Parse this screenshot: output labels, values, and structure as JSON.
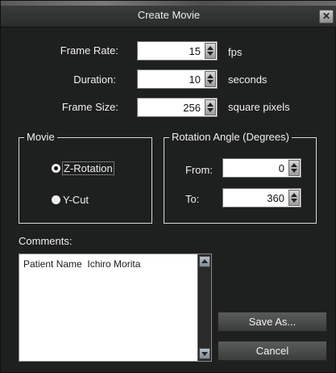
{
  "window": {
    "title": "Create Movie",
    "close_glyph": "✕"
  },
  "fields": {
    "frame_rate": {
      "label": "Frame Rate:",
      "value": "15",
      "unit": "fps"
    },
    "duration": {
      "label": "Duration:",
      "value": "10",
      "unit": "seconds"
    },
    "frame_size": {
      "label": "Frame Size:",
      "value": "256",
      "unit": "square pixels"
    }
  },
  "movie_group": {
    "legend": "Movie",
    "options": [
      {
        "label": "Z-Rotation",
        "selected": true
      },
      {
        "label": "Y-Cut",
        "selected": false
      }
    ]
  },
  "rotation_group": {
    "legend": "Rotation Angle (Degrees)",
    "from": {
      "label": "From:",
      "value": "0"
    },
    "to": {
      "label": "To:",
      "value": "360"
    }
  },
  "comments": {
    "label": "Comments:",
    "value": "Patient Name  Ichiro Morita"
  },
  "buttons": {
    "save_as": "Save As...",
    "cancel": "Cancel"
  },
  "icons": {
    "close": "close-icon",
    "spin_up": "chevron-up-icon",
    "spin_down": "chevron-down-icon"
  }
}
